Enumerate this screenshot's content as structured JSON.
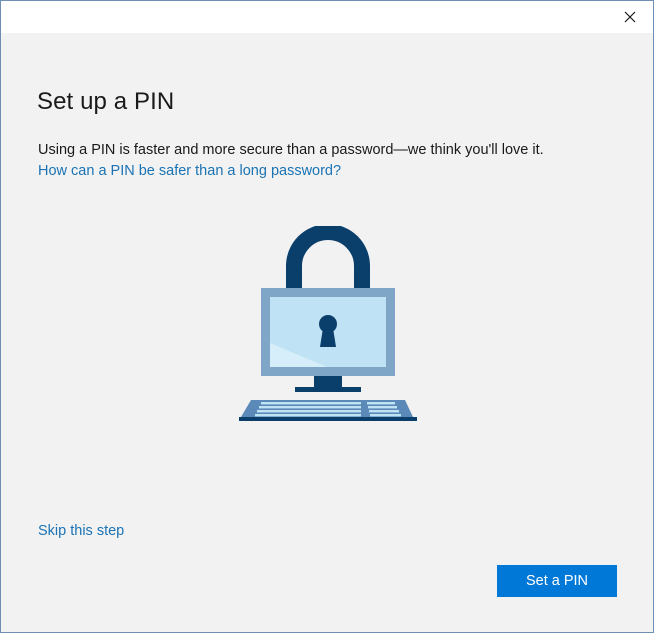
{
  "window": {
    "close_glyph": "✕"
  },
  "main": {
    "title": "Set up a PIN",
    "description": "Using a PIN is faster and more secure than a password—we think you'll love it.",
    "help_link": "How can a PIN be safer than a long password?",
    "illustration_icon": "padlock-computer-illustration",
    "skip_link": "Skip this step",
    "primary_button": "Set a PIN"
  },
  "colors": {
    "accent": "#0078d7",
    "link": "#1a73b5",
    "lock_dark": "#0b3f6b",
    "monitor_frame": "#7fa6c6",
    "screen": "#bfe3f5"
  }
}
